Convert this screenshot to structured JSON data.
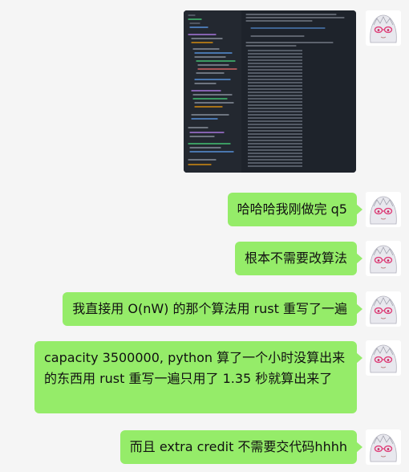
{
  "conversation": {
    "messages": [
      {
        "sender": "self",
        "type": "image",
        "alt": "code-editor-screenshot"
      },
      {
        "sender": "self",
        "type": "text",
        "text": "哈哈哈我刚做完 q5"
      },
      {
        "sender": "self",
        "type": "text",
        "text": "根本不需要改算法"
      },
      {
        "sender": "self",
        "type": "text",
        "text": "我直接用 O(nW) 的那个算法用 rust 重写了一遍"
      },
      {
        "sender": "self",
        "type": "text",
        "text": "capacity 3500000, python 算了一个小时没算出来的东西用 rust 重写一遍只用了 1.35 秒就算出来了"
      },
      {
        "sender": "self",
        "type": "text",
        "text": "而且 extra credit 不需要交代码hhhh"
      }
    ]
  },
  "colors": {
    "background": "#f5f5f5",
    "bubble_self": "#95ec69",
    "code_bg": "#1e232b"
  }
}
